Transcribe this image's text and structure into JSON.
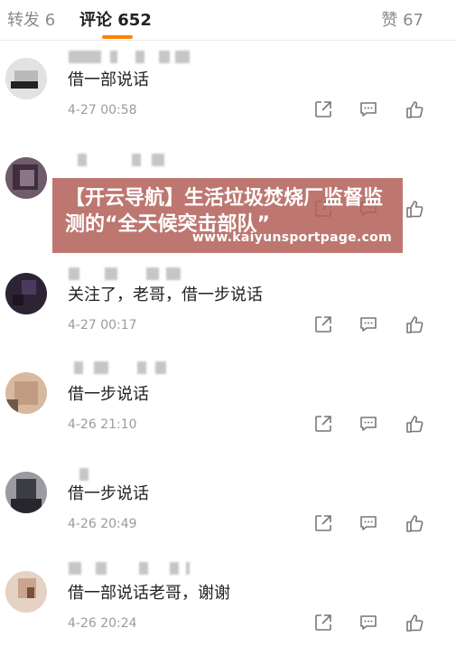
{
  "tabs": {
    "forward": "转发 6",
    "comment": "评论 652",
    "like": "赞 67"
  },
  "comments": [
    {
      "text": "借一部说话",
      "time": "4-27 00:58"
    },
    {
      "text": "",
      "time": ""
    },
    {
      "text": "关注了，老哥，借一步说话",
      "time": "4-27 00:17"
    },
    {
      "text": "借一步说话",
      "time": "4-26 21:10"
    },
    {
      "text": "借一步说话",
      "time": "4-26 20:49"
    },
    {
      "text": "借一部说话老哥，谢谢",
      "time": "4-26 20:24"
    }
  ],
  "icons": {
    "share": "share-icon",
    "reply": "comment-icon",
    "like": "thumbs-up-icon"
  },
  "watermark": {
    "line1": "【开云导航】生活垃圾焚烧厂监督监",
    "line2": "测的“全天候突击部队”",
    "url": "www.kaiyunsportpage.com"
  },
  "colors": {
    "accent": "#ff8200",
    "watermark_bg": "#b26158",
    "muted_text": "#9b9b9b"
  }
}
